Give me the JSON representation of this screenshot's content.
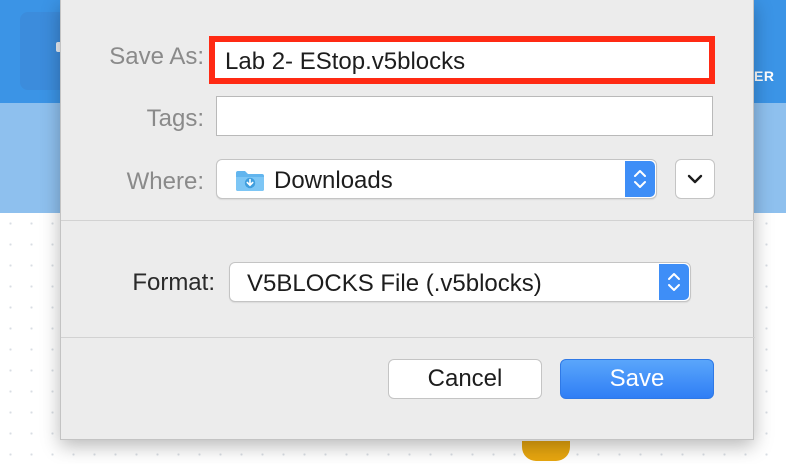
{
  "background_app": {
    "header_right_label": "ER"
  },
  "dialog": {
    "save_as": {
      "label": "Save As:",
      "value": "Lab 2- EStop.v5blocks"
    },
    "tags": {
      "label": "Tags:",
      "value": ""
    },
    "where": {
      "label": "Where:",
      "value": "Downloads",
      "icon": "downloads-folder-icon"
    },
    "format": {
      "label": "Format:",
      "value": "V5BLOCKS File (.v5blocks)"
    },
    "buttons": {
      "cancel": "Cancel",
      "save": "Save"
    }
  },
  "colors": {
    "accent": "#3e8ef7",
    "highlight_border": "#ff2a14",
    "app_header": "#3b94e6"
  }
}
